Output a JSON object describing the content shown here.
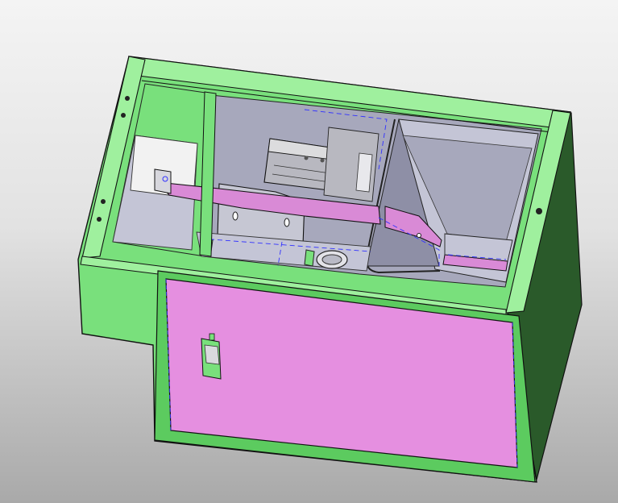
{
  "scene": {
    "background": {
      "top": "#f4f4f4",
      "mid": "#e2e2e2",
      "bottom": "#a9a9a9"
    },
    "colors": {
      "housing": "#79e07c",
      "housing_light": "#9ff09e",
      "housing_dark": "#2a5a2a",
      "housing_mid": "#5ccb5f",
      "panel": "#e58fe0",
      "panel_light": "#f3b2ef",
      "interior": "#a7a8bc",
      "interior_dark": "#8e8fa6",
      "interior_light": "#c4c5d6",
      "bracket": "#d98ad6",
      "rail": "#b8b8c0",
      "outline": "#1c1c1c",
      "hidden_line": "#3131ff"
    },
    "visible_text": []
  }
}
